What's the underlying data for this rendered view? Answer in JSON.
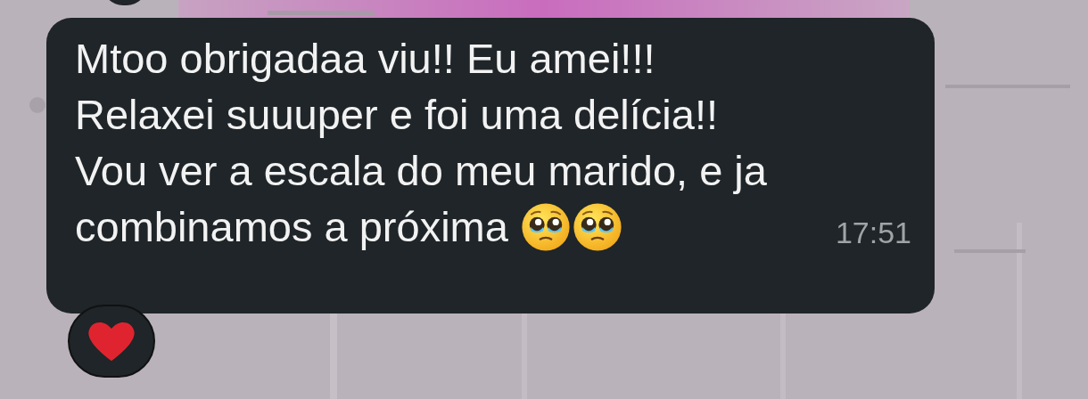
{
  "message": {
    "text": "Mtoo obrigadaa viu!! Eu amei!!!\nRelaxei suuuper e foi uma delícia!!\nVou ver a escala do meu marido, e ja\ncombinamos a próxima",
    "emoji": [
      {
        "kind": "pleading-face"
      },
      {
        "kind": "pleading-face"
      }
    ],
    "time": "17:51",
    "reaction": {
      "kind": "heart"
    }
  }
}
